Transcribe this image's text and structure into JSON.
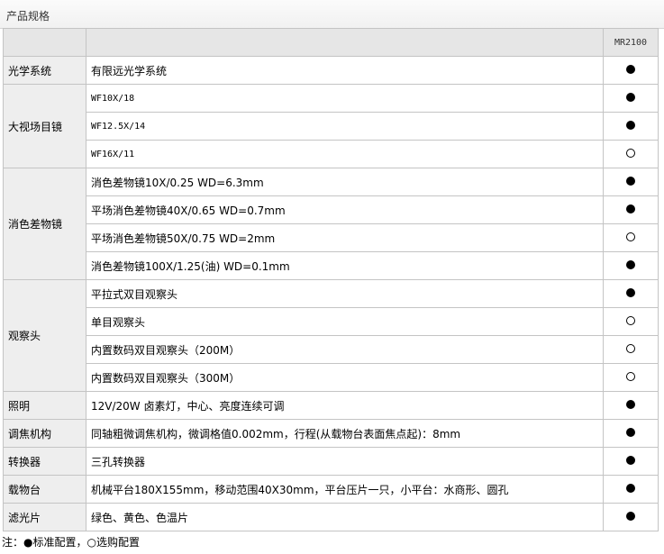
{
  "section_title": "产品规格",
  "model": "MR2100",
  "rows": [
    {
      "category": "光学系统",
      "item": "有限远光学系统",
      "standard": true
    },
    {
      "category": "大视场目镜",
      "item": "WF10X/18",
      "standard": true
    },
    {
      "category": "",
      "item": "WF12.5X/14",
      "standard": true
    },
    {
      "category": "",
      "item": "WF16X/11",
      "standard": false
    },
    {
      "category": "消色差物镜",
      "item": "消色差物镜10X/0.25 WD=6.3mm",
      "standard": true
    },
    {
      "category": "",
      "item": "平场消色差物镜40X/0.65 WD=0.7mm",
      "standard": true
    },
    {
      "category": "",
      "item": "平场消色差物镜50X/0.75 WD=2mm",
      "standard": false
    },
    {
      "category": "",
      "item": "消色差物镜100X/1.25(油) WD=0.1mm",
      "standard": true
    },
    {
      "category": "观察头",
      "item": "平拉式双目观察头",
      "standard": true
    },
    {
      "category": "",
      "item": "单目观察头",
      "standard": false
    },
    {
      "category": "",
      "item": "内置数码双目观察头（200M）",
      "standard": false
    },
    {
      "category": "",
      "item": "内置数码双目观察头（300M）",
      "standard": false
    },
    {
      "category": "照明",
      "item": "12V/20W 卤素灯，中心、亮度连续可调",
      "standard": true
    },
    {
      "category": "调焦机构",
      "item": "同轴粗微调焦机构，微调格值0.002mm，行程(从载物台表面焦点起)：8mm",
      "standard": true
    },
    {
      "category": "转换器",
      "item": "三孔转换器",
      "standard": true
    },
    {
      "category": "载物台",
      "item": "机械平台180X155mm，移动范围40X30mm，平台压片一只，小平台：水商形、圆孔",
      "standard": true
    },
    {
      "category": "滤光片",
      "item": "绿色、黄色、色温片",
      "standard": true
    }
  ],
  "note": "注：●标准配置，○选购配置"
}
